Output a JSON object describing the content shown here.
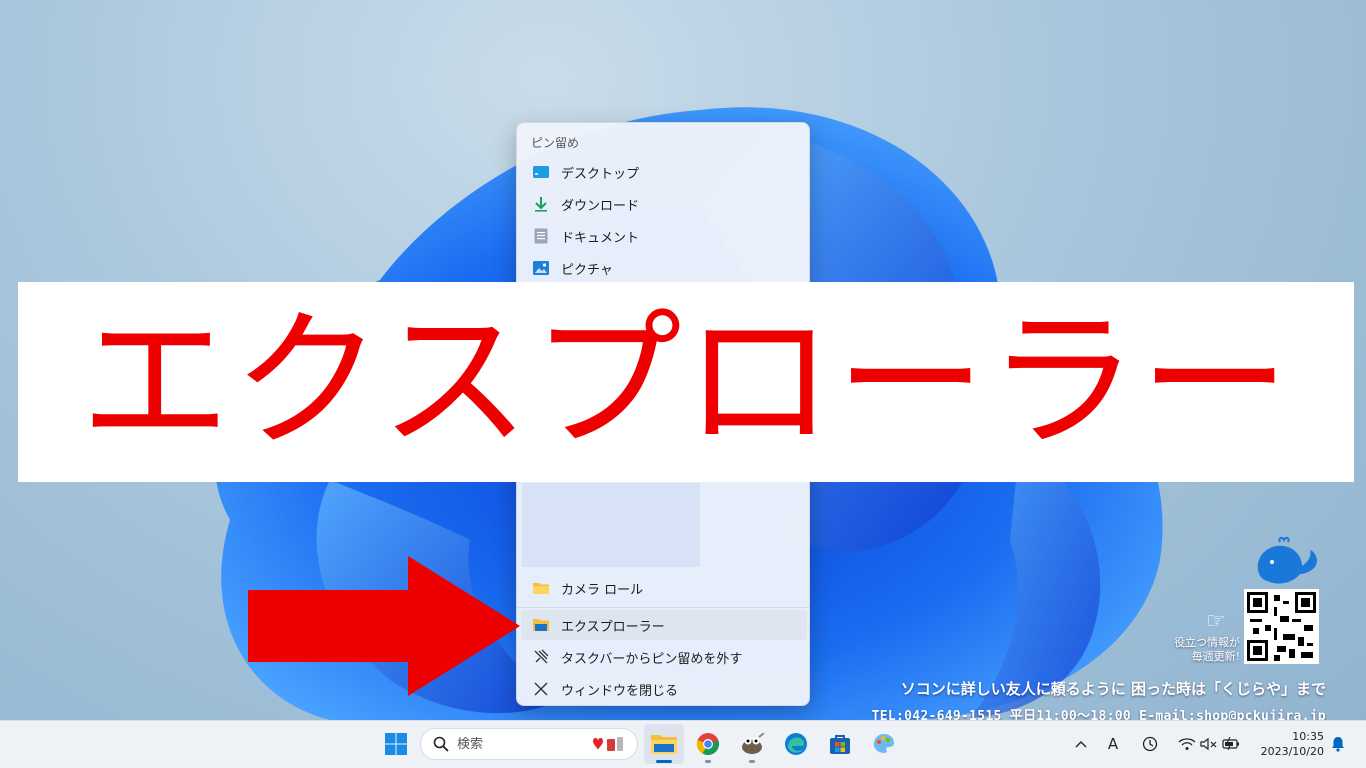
{
  "jumplist": {
    "header": "ピン留め",
    "pinned": [
      {
        "label": "デスクトップ",
        "icon": "desktop-folder-icon"
      },
      {
        "label": "ダウンロード",
        "icon": "download-arrow-icon"
      },
      {
        "label": "ドキュメント",
        "icon": "document-icon"
      },
      {
        "label": "ピクチャ",
        "icon": "pictures-icon"
      }
    ],
    "recent": [
      {
        "label": "カメラ ロール",
        "icon": "folder-icon"
      }
    ],
    "actions": [
      {
        "label": "エクスプローラー",
        "icon": "file-explorer-icon"
      },
      {
        "label": "タスクバーからピン留めを外す",
        "icon": "unpin-icon"
      },
      {
        "label": "ウィンドウを閉じる",
        "icon": "close-icon"
      }
    ]
  },
  "banner": {
    "text": "エクスプローラー",
    "color": "#ee0000"
  },
  "shop": {
    "line1": "ソコンに詳しい友人に頼るように 困った時は「くじらや」まで",
    "line2": "TEL:042-649-1515 平日11:00～18:00  E-mail:shop@pckujira.jp",
    "tagline_1": "役立つ情報が",
    "tagline_2": "毎週更新!"
  },
  "taskbar": {
    "search_placeholder": "検索",
    "apps": [
      "start-icon",
      "file-explorer-icon",
      "chrome-icon",
      "gimp-icon",
      "edge-icon",
      "store-icon",
      "paint-icon"
    ],
    "time": "10:35",
    "date": "2023/10/20",
    "ime_label": "A"
  },
  "colors": {
    "accent": "#0067c0",
    "arrow": "#ee0000"
  }
}
